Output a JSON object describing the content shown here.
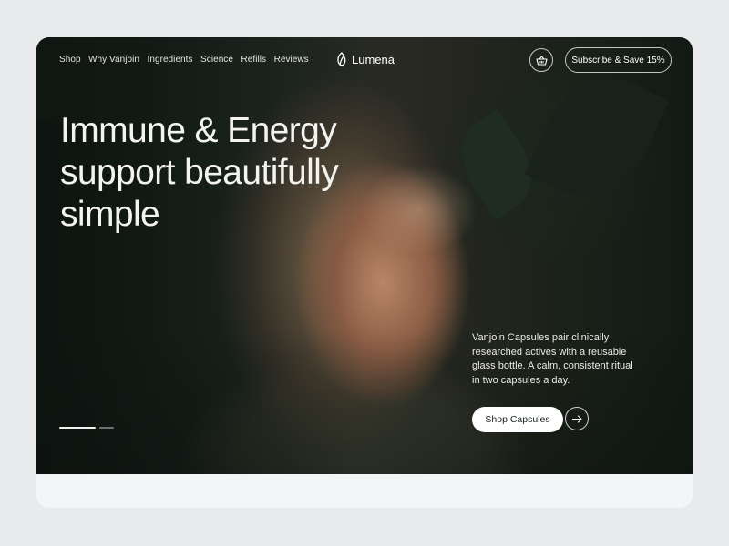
{
  "nav": {
    "items": [
      "Shop",
      "Why Vanjoin",
      "Ingredients",
      "Science",
      "Refills",
      "Reviews"
    ]
  },
  "brand": {
    "name": "Lumena",
    "icon": "leaf-logo-icon"
  },
  "header": {
    "cart_icon": "basket-icon",
    "subscribe_label": "Subscribe & Save 15%"
  },
  "hero": {
    "headline_lines": [
      "Immune & Energy",
      "support beautifully",
      "simple"
    ],
    "description": "Vanjoin Capsules pair clinically researched actives with a reusable glass bottle. A calm, consistent ritual in two capsules a day.",
    "cta_label": "Shop Capsules",
    "cta_arrow_icon": "arrow-right-icon",
    "slide_indicator": {
      "total": 2,
      "active": 1
    }
  },
  "colors": {
    "page_background": "#e9eaec",
    "hero_dark_green": "#1c2620",
    "text_light": "#f3f3f0",
    "button_white": "#ffffff"
  }
}
